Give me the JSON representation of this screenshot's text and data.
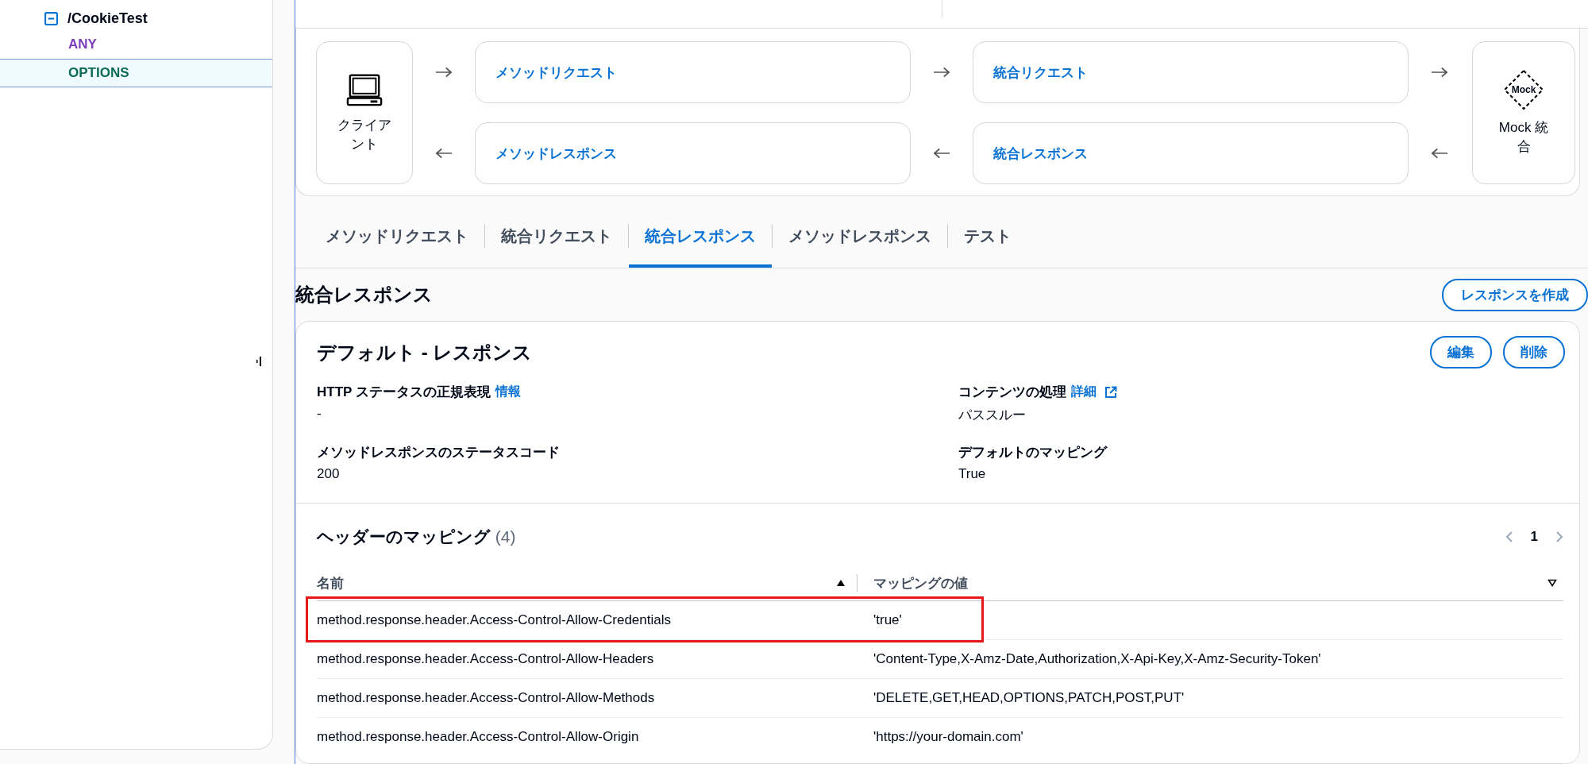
{
  "sidebar": {
    "tree": [
      {
        "label": "/CookieTest",
        "expanded": true,
        "children": [
          {
            "label": "ANY",
            "color": "#7d3cbe",
            "selected": false
          },
          {
            "label": "OPTIONS",
            "color": "#0b6b57",
            "selected": true
          }
        ]
      }
    ]
  },
  "flow": {
    "client": "クライアント",
    "requests": [
      "メソッドリクエスト",
      "統合リクエスト"
    ],
    "responses": [
      "メソッドレスポンス",
      "統合レスポンス"
    ],
    "mock_badge": "Mock",
    "integration": "Mock 統合"
  },
  "tabs": [
    {
      "label": "メソッドリクエスト",
      "selected": false
    },
    {
      "label": "統合リクエスト",
      "selected": false
    },
    {
      "label": "統合レスポンス",
      "selected": true
    },
    {
      "label": "メソッドレスポンス",
      "selected": false
    },
    {
      "label": "テスト",
      "selected": false
    }
  ],
  "section": {
    "title": "統合レスポンス",
    "create_button": "レスポンスを作成"
  },
  "default_response": {
    "title": "デフォルト - レスポンス",
    "buttons": [
      "編集",
      "削除"
    ],
    "fields": [
      {
        "label": "HTTP ステータスの正規表現",
        "link": "情報",
        "value": "-"
      },
      {
        "label": "コンテンツの処理",
        "link": "詳細",
        "external": true,
        "value": "パススルー"
      },
      {
        "label": "メソッドレスポンスのステータスコード",
        "value": "200"
      },
      {
        "label": "デフォルトのマッピング",
        "value": "True"
      }
    ]
  },
  "header_mappings": {
    "title": "ヘッダーのマッピング",
    "count": "(4)",
    "page": "1",
    "columns": [
      {
        "label": "名前",
        "sorted": true
      },
      {
        "label": "マッピングの値",
        "sorted": false
      }
    ],
    "rows": [
      {
        "name": "method.response.header.Access-Control-Allow-Credentials",
        "value": "'true'",
        "highlighted": true
      },
      {
        "name": "method.response.header.Access-Control-Allow-Headers",
        "value": "'Content-Type,X-Amz-Date,Authorization,X-Api-Key,X-Amz-Security-Token'",
        "highlighted": false
      },
      {
        "name": "method.response.header.Access-Control-Allow-Methods",
        "value": "'DELETE,GET,HEAD,OPTIONS,PATCH,POST,PUT'",
        "highlighted": false
      },
      {
        "name": "method.response.header.Access-Control-Allow-Origin",
        "value": "'https://your-domain.com'",
        "highlighted": false
      }
    ]
  }
}
